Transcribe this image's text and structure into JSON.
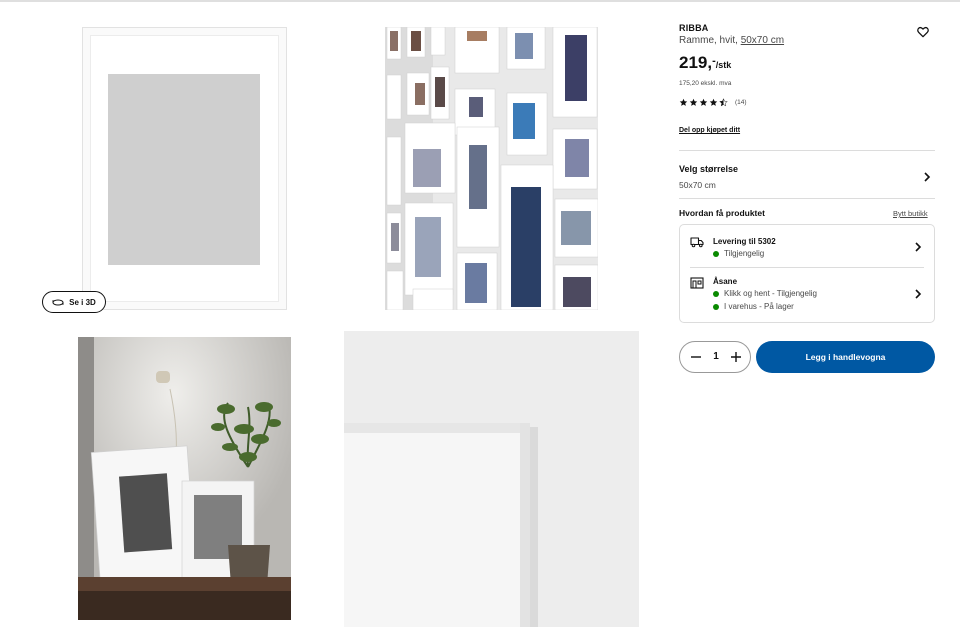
{
  "gallery": {
    "see_3d_label": "Se i 3D",
    "images": [
      {
        "name": "product-image-white-frame"
      },
      {
        "name": "product-image-gallery-wall"
      },
      {
        "name": "product-image-shelf-lamp-plant"
      },
      {
        "name": "product-image-frame-closeup"
      }
    ]
  },
  "product": {
    "name": "RIBBA",
    "description_prefix": "Ramme, hvit, ",
    "size_link": "50x70 cm",
    "price_main": "219,",
    "price_dash": "-",
    "price_unit": "/stk",
    "price_excl_vat": "175,20 ekskl. mva",
    "rating": 4.5,
    "review_count": "(14)",
    "split_payment_link": "Del opp kjøpet ditt",
    "favorite_icon": "heart-icon"
  },
  "size_selector": {
    "title": "Velg størrelse",
    "value": "50x70 cm"
  },
  "delivery": {
    "heading": "Hvordan få produktet",
    "change_store": "Bytt butikk",
    "shipping": {
      "icon": "truck-icon",
      "title": "Levering til 5302",
      "status": "Tilgjengelig"
    },
    "store": {
      "icon": "store-icon",
      "title": "Åsane",
      "status_click": "Klikk og hent - Tilgjengelig",
      "status_stock": "I varehus - På lager"
    }
  },
  "cart": {
    "quantity": "1",
    "add_label": "Legg i handlevogna"
  },
  "colors": {
    "brand_blue": "#0058a3",
    "available_green": "#0a8a00"
  }
}
